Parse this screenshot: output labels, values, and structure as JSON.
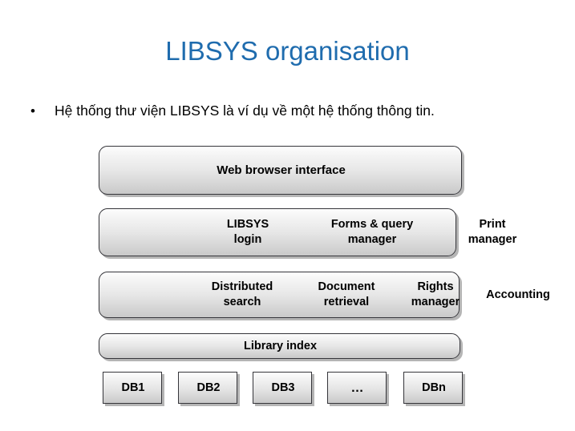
{
  "slide": {
    "title": "LIBSYS organisation",
    "title_color": "#1F6CAE",
    "background_color": "#FFFFFF",
    "bullets": [
      {
        "marker": "•",
        "text": "Hệ thống thư viện LIBSYS là ví dụ về một hệ thống thông tin."
      }
    ]
  },
  "diagram": {
    "name": "LIBSYS layered architecture",
    "box_fill_top": "#FDFDFD",
    "box_fill_bottom": "#C9C9C9",
    "box_border": "#35353A",
    "layers": [
      {
        "id": "web-browser",
        "shape": "rounded",
        "cells": [
          {
            "id": "web-browser-interface",
            "lines": [
              "Web browser interface"
            ]
          }
        ]
      },
      {
        "id": "services",
        "shape": "rounded",
        "cells": [
          {
            "id": "libsys-login",
            "lines": [
              "LIBSYS",
              "login"
            ]
          },
          {
            "id": "forms-query",
            "lines": [
              "Forms & query",
              "manager"
            ]
          },
          {
            "id": "print-manager",
            "lines": [
              "Print",
              "manager"
            ]
          }
        ]
      },
      {
        "id": "core",
        "shape": "rounded",
        "cells": [
          {
            "id": "distributed-search",
            "lines": [
              "Distributed",
              "search"
            ]
          },
          {
            "id": "document-retrieval",
            "lines": [
              "Document",
              "retrieval"
            ]
          },
          {
            "id": "rights-manager",
            "lines": [
              "Rights",
              "manager"
            ]
          },
          {
            "id": "accounting",
            "lines": [
              "Accounting"
            ]
          }
        ]
      },
      {
        "id": "library-index",
        "shape": "rounded",
        "cells": [
          {
            "id": "library-index",
            "lines": [
              "Library index"
            ]
          }
        ]
      },
      {
        "id": "databases",
        "shape": "square",
        "cells": [
          {
            "id": "db1",
            "lines": [
              "DB1"
            ]
          },
          {
            "id": "db2",
            "lines": [
              "DB2"
            ]
          },
          {
            "id": "db3",
            "lines": [
              "DB3"
            ]
          },
          {
            "id": "db-dots",
            "lines": [
              "…"
            ]
          },
          {
            "id": "dbn",
            "lines": [
              "DBn"
            ]
          }
        ]
      }
    ]
  }
}
